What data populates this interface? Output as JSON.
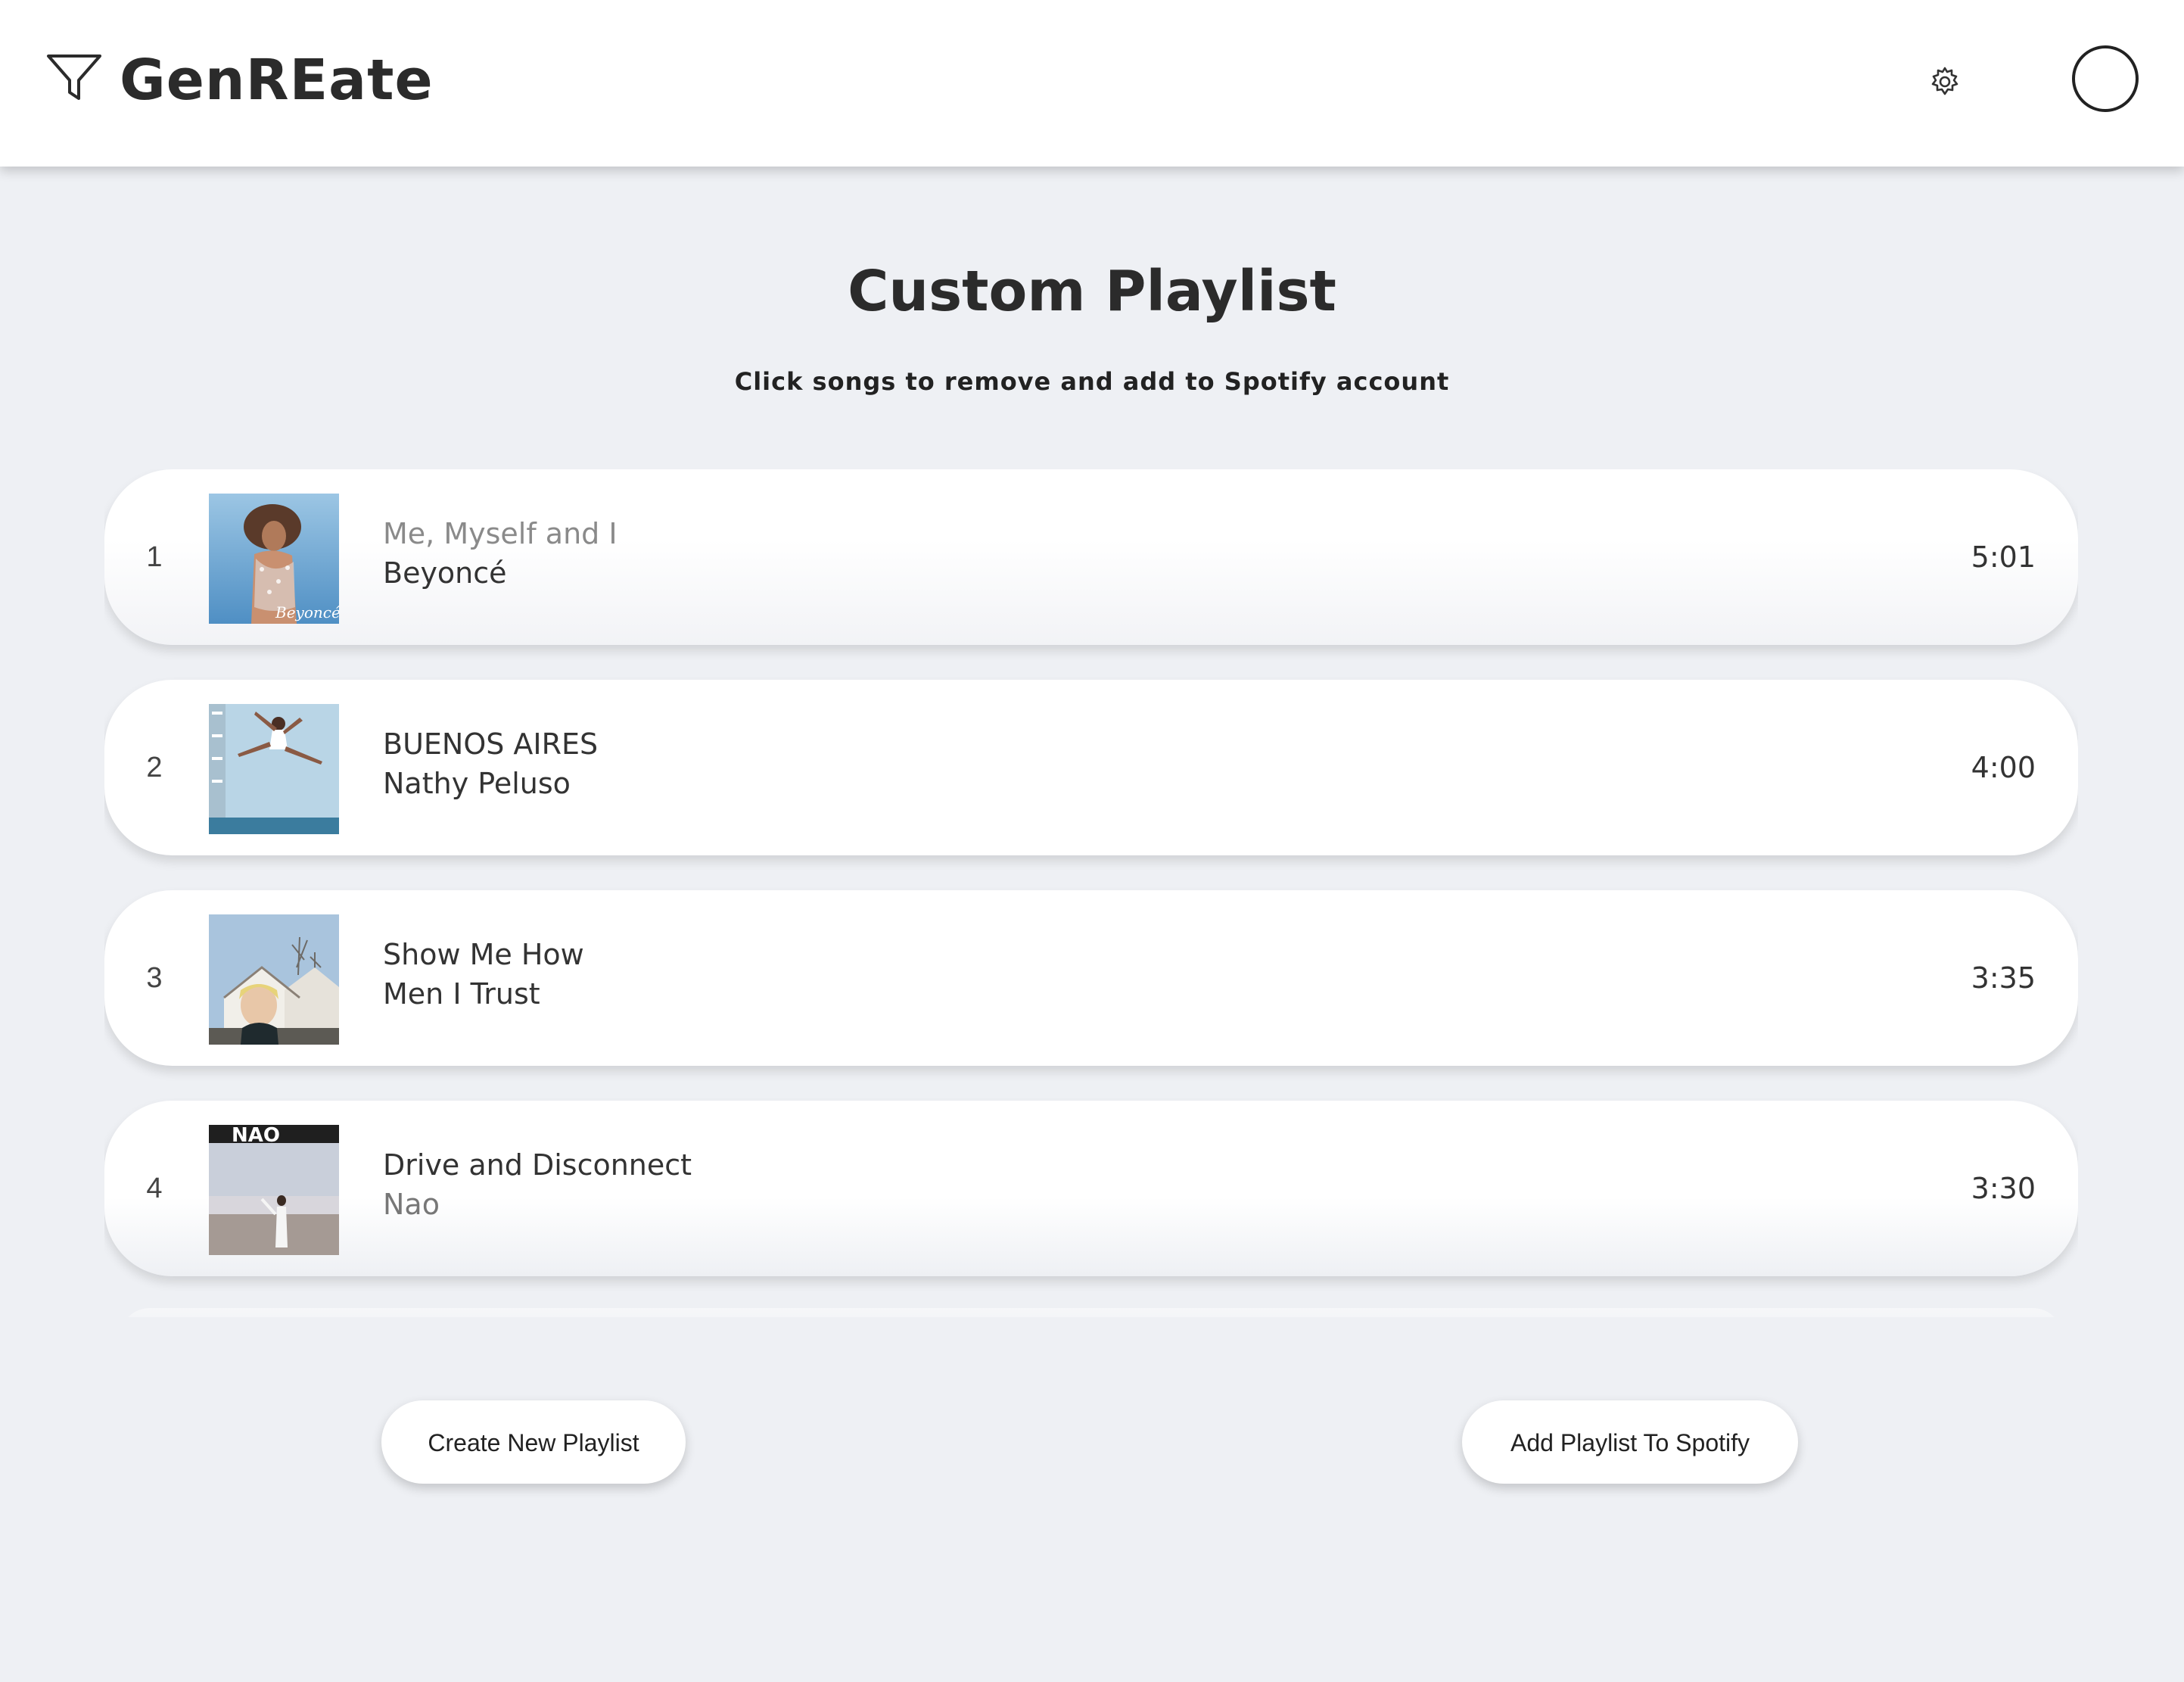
{
  "header": {
    "app_title": "GenREate",
    "logo_icon": "funnel-filter-icon",
    "settings_icon": "gear-icon",
    "avatar_icon": "profile-avatar-circle"
  },
  "main": {
    "title": "Custom Playlist",
    "subtitle": "Click songs to remove and add to Spotify account"
  },
  "songs": [
    {
      "number": "1",
      "title": "Me, Myself and I",
      "artist": "Beyoncé",
      "duration": "5:01",
      "cover_text": "Beyoncé"
    },
    {
      "number": "2",
      "title": "BUENOS AIRES",
      "artist": "Nathy Peluso",
      "duration": "4:00"
    },
    {
      "number": "3",
      "title": "Show Me How",
      "artist": "Men I Trust",
      "duration": "3:35"
    },
    {
      "number": "4",
      "title": "Drive and Disconnect",
      "artist": "Nao",
      "duration": "3:30",
      "cover_text": "NAO"
    }
  ],
  "actions": {
    "create_label": "Create New Playlist",
    "add_label": "Add Playlist To Spotify"
  },
  "colors": {
    "background": "#eef0f4",
    "card": "#ffffff",
    "text": "#2b2b2b"
  }
}
